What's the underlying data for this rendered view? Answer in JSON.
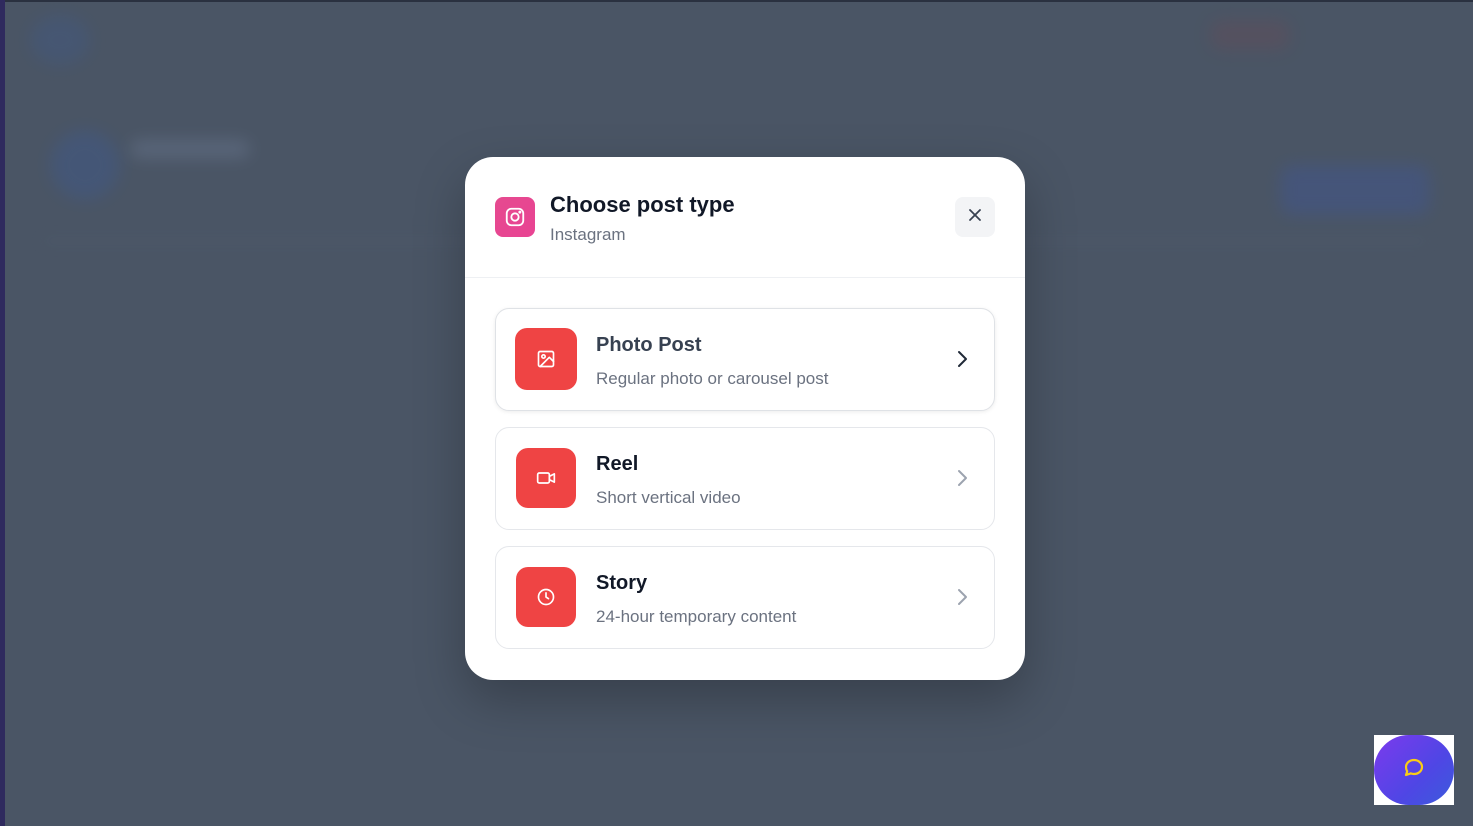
{
  "modal": {
    "title": "Choose post type",
    "subtitle": "Instagram",
    "brand_icon": "instagram-icon",
    "close_icon": "close-icon"
  },
  "options": [
    {
      "title": "Photo Post",
      "description": "Regular photo or carousel post",
      "icon": "image-icon",
      "chevron": "chevron-right-icon"
    },
    {
      "title": "Reel",
      "description": "Short vertical video",
      "icon": "video-icon",
      "chevron": "chevron-right-icon"
    },
    {
      "title": "Story",
      "description": "24-hour temporary content",
      "icon": "clock-icon",
      "chevron": "chevron-right-icon"
    }
  ],
  "chat": {
    "icon": "chat-bubble-icon"
  },
  "colors": {
    "backdrop": "#4a5565",
    "option_icon_bg": "#ef4444",
    "instagram_pink": "#e84393",
    "chat_gradient_start": "#7c3aed",
    "chat_gradient_end": "#3b5bdb",
    "chat_icon": "#facc15"
  }
}
